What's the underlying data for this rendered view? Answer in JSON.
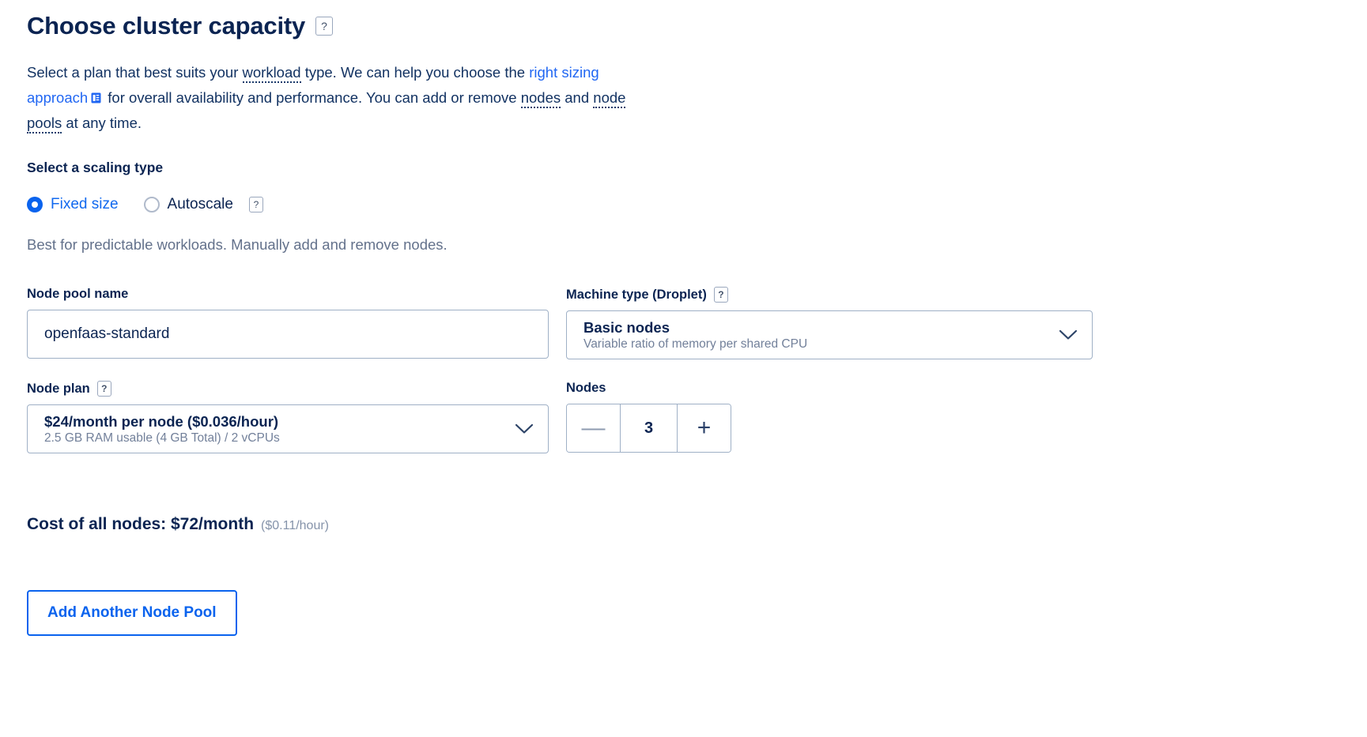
{
  "header": {
    "title": "Choose cluster capacity",
    "help_icon_label": "?"
  },
  "intro": {
    "part1": "Select a plan that best suits your ",
    "term_workload": "workload",
    "part2": " type. We can help you choose the ",
    "link_text": "right sizing approach",
    "part3": " for overall availability and performance. You can add or remove ",
    "term_nodes": "nodes",
    "part4": " and ",
    "term_node_pools": "node pools",
    "part5": " at any time."
  },
  "scaling": {
    "label": "Select a scaling type",
    "options": [
      {
        "label": "Fixed size",
        "selected": true
      },
      {
        "label": "Autoscale",
        "selected": false
      }
    ],
    "autoscale_help_label": "?",
    "helper_text": "Best for predictable workloads. Manually add and remove nodes."
  },
  "fields": {
    "node_pool_name": {
      "label": "Node pool name",
      "value": "openfaas-standard",
      "placeholder": "Node pool name"
    },
    "machine_type": {
      "label": "Machine type (Droplet)",
      "help_label": "?",
      "selected_title": "Basic nodes",
      "selected_sub": "Variable ratio of memory per shared CPU"
    },
    "node_plan": {
      "label": "Node plan",
      "help_label": "?",
      "selected_title": "$24/month per node ($0.036/hour)",
      "selected_sub": "2.5 GB RAM usable (4 GB Total) / 2 vCPUs"
    },
    "nodes": {
      "label": "Nodes",
      "value": "3",
      "decrement_label": "—",
      "increment_label": "+"
    }
  },
  "cost": {
    "main": "Cost of all nodes: $72/month",
    "sub": "($0.11/hour)"
  },
  "actions": {
    "add_node_pool": "Add Another Node Pool"
  },
  "colors": {
    "accent_blue": "#0a63ee",
    "link_blue": "#2167f3",
    "navy": "#0b2452",
    "muted": "#63718b",
    "border": "#9fb0c6"
  }
}
